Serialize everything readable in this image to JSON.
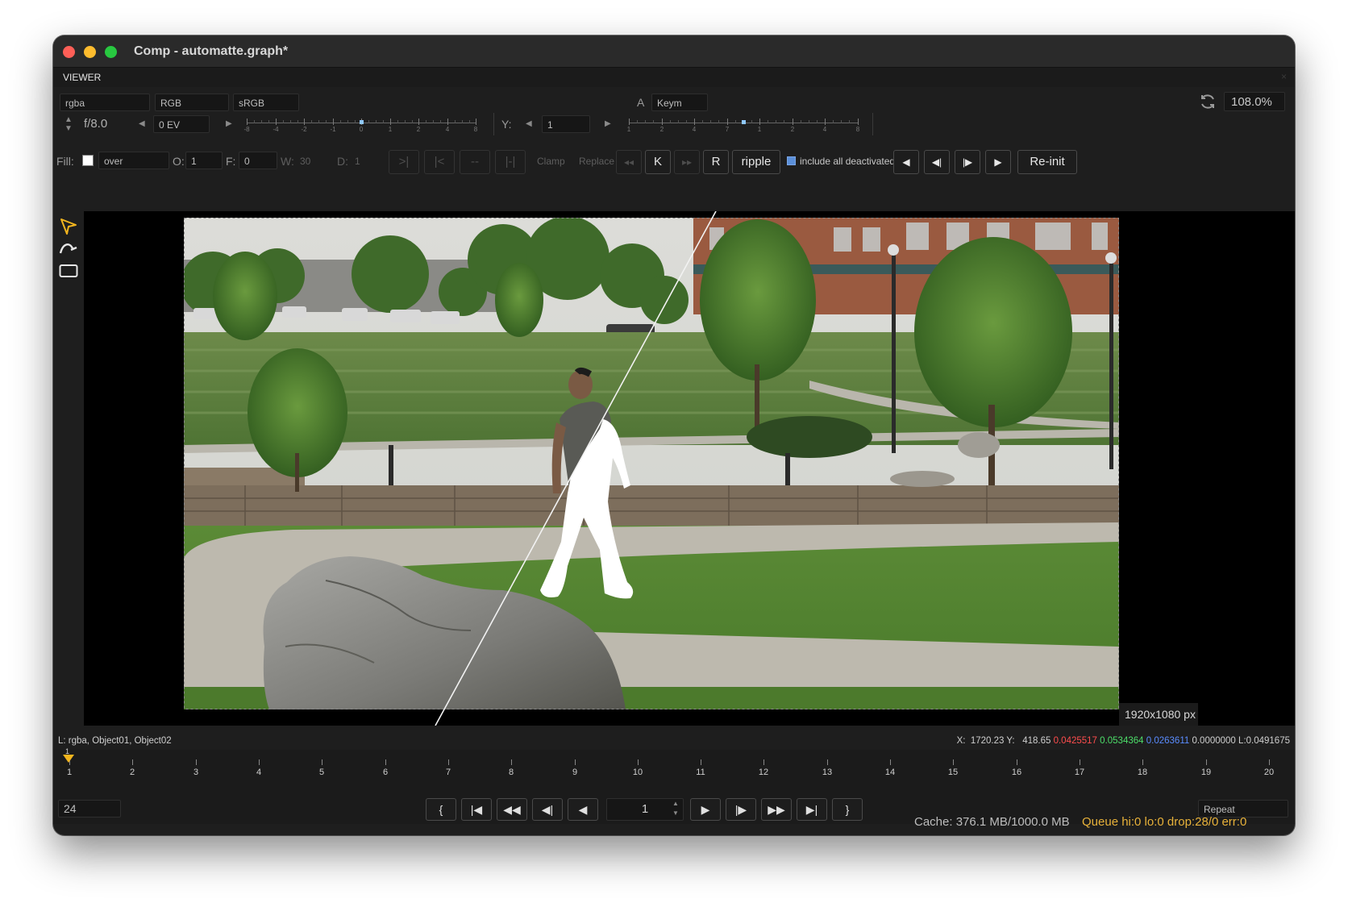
{
  "window": {
    "title": "Comp - automatte.graph*"
  },
  "tabs": {
    "viewer": "VIEWER",
    "close": "×"
  },
  "toolbar1": {
    "channel": "rgba",
    "colorspace": "RGB",
    "display": "sRGB",
    "alpha_label": "A",
    "alpha_channel": "Keym",
    "zoom": "108.0%"
  },
  "toolbar2": {
    "fstop": "f/8.0",
    "exposure": "0 EV",
    "y_label": "Y:",
    "y_value": "1",
    "exposure_ticks": [
      "-8",
      "-4",
      "-2",
      "-1",
      "0",
      "1",
      "2",
      "4",
      "8"
    ],
    "gamma_ticks": [
      "1",
      "2",
      "4",
      "7",
      "1",
      "2",
      "4",
      "8"
    ]
  },
  "toolbar3": {
    "fill_label": "Fill:",
    "blend_mode": "over",
    "o_label": "O:",
    "o_value": "1",
    "f_label": "F:",
    "f_value": "0",
    "w_label": "W:",
    "w_value": "30",
    "d_label": "D:",
    "d_value": "1",
    "clamp": "Clamp",
    "replace": "Replace",
    "key_k": "K",
    "key_r": "R",
    "ripple": "ripple",
    "include_all": "include all deactivated",
    "reinit": "Re-init"
  },
  "viewer": {
    "resolution": "1920x1080 px"
  },
  "status": {
    "layers": "L: rgba, Object01, Object02",
    "xy": "X:  1720.23 Y:   418.65",
    "r": "0.0425517",
    "g": "0.0534364",
    "b": "0.0263611",
    "a": "0.0000000",
    "l": "L:0.0491675",
    "colors": {
      "r": "#ff4d4d",
      "g": "#4ddf6a",
      "b": "#5a8cff"
    }
  },
  "timeline": {
    "frames": [
      "1",
      "2",
      "3",
      "4",
      "5",
      "6",
      "7",
      "8",
      "9",
      "10",
      "11",
      "12",
      "13",
      "14",
      "15",
      "16",
      "17",
      "18",
      "19",
      "20"
    ],
    "current_marker": "1",
    "fps": "24",
    "frame": "1",
    "loop_mode": "Repeat"
  },
  "footer": {
    "cache": "Cache: 376.1 MB/1000.0 MB",
    "queue": "Queue hi:0 lo:0 drop:28/0 err:0",
    "queue_color": "#e8b23a"
  }
}
